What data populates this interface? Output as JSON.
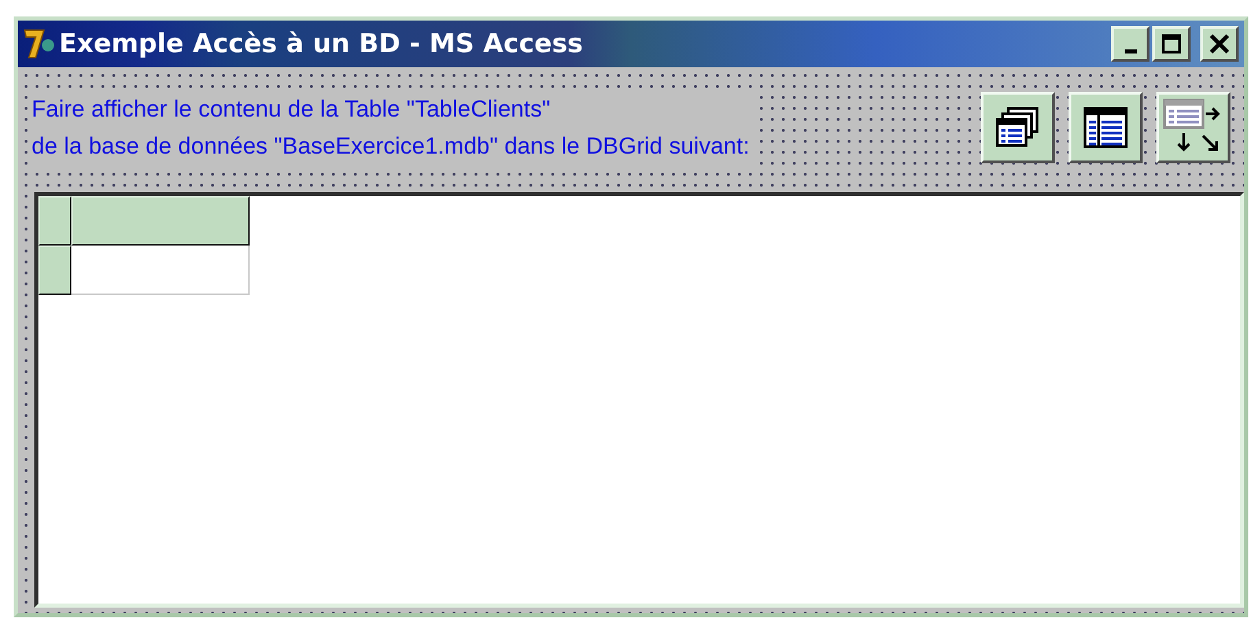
{
  "window": {
    "title": "Exemple Accès à un BD - MS Access"
  },
  "label": {
    "lines": [
      "Faire afficher le contenu de la Table \"TableClients\"",
      "de la base de données \"BaseExercice1.mdb\" dans le DBGrid suivant:"
    ]
  },
  "toolbar": {
    "buttons": [
      {
        "kind": "tables"
      },
      {
        "kind": "grid"
      },
      {
        "kind": "transfer"
      }
    ]
  }
}
